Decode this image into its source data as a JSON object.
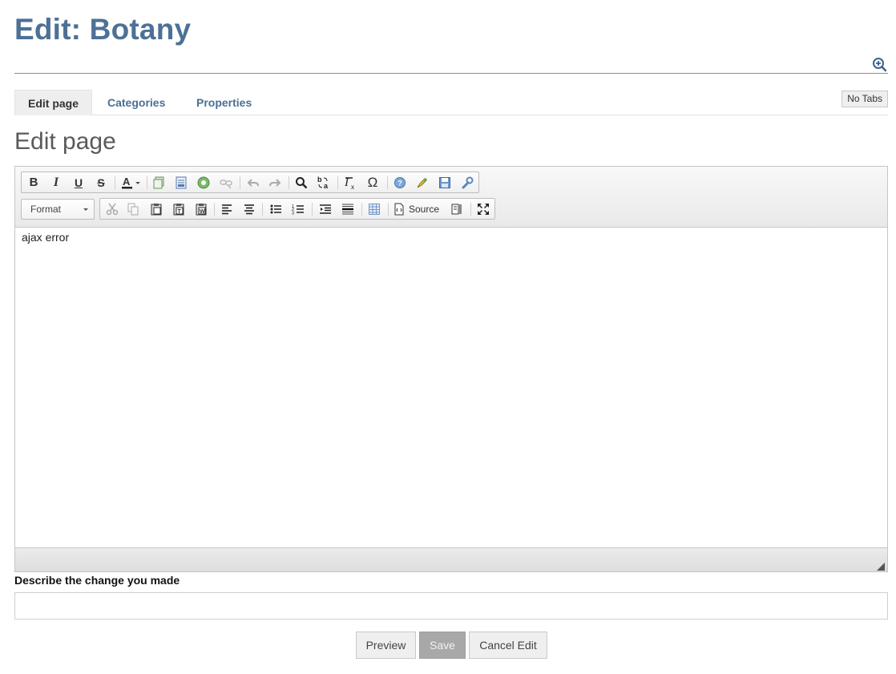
{
  "page": {
    "title": "Edit: Botany"
  },
  "header": {
    "zoom_icon": "zoom-in-icon"
  },
  "tabs": [
    {
      "label": "Edit page",
      "active": true
    },
    {
      "label": "Categories",
      "active": false
    },
    {
      "label": "Properties",
      "active": false
    }
  ],
  "no_tabs_label": "No Tabs",
  "section_title": "Edit page",
  "editor": {
    "toolbar_row1": [
      "bold-icon",
      "italic-icon",
      "underline-icon",
      "strikethrough-icon",
      "text-color-icon",
      "copy-formatting-icon",
      "templates-icon",
      "image-icon",
      "unlink-icon",
      "undo-icon",
      "redo-icon",
      "find-icon",
      "replace-icon",
      "remove-format-icon",
      "special-char-icon",
      "help-icon",
      "highlight-icon",
      "save-icon",
      "settings-icon"
    ],
    "format_label": "Format",
    "toolbar_row2": [
      "cut-icon",
      "copy-icon",
      "paste-icon",
      "paste-text-icon",
      "paste-word-icon",
      "align-left-icon",
      "align-center-icon",
      "bulleted-list-icon",
      "numbered-list-icon",
      "outdent-icon",
      "horizontal-rule-icon",
      "table-icon",
      "source-icon",
      "show-blocks-icon",
      "maximize-icon"
    ],
    "source_label": "Source",
    "content": "ajax error"
  },
  "summary": {
    "label": "Describe the change you made",
    "value": "",
    "placeholder": ""
  },
  "buttons": {
    "preview": "Preview",
    "save": "Save",
    "cancel": "Cancel Edit"
  },
  "colors": {
    "title": "#4d7196",
    "link": "#4a6f95",
    "save_disabled": "#a8a8a8"
  }
}
